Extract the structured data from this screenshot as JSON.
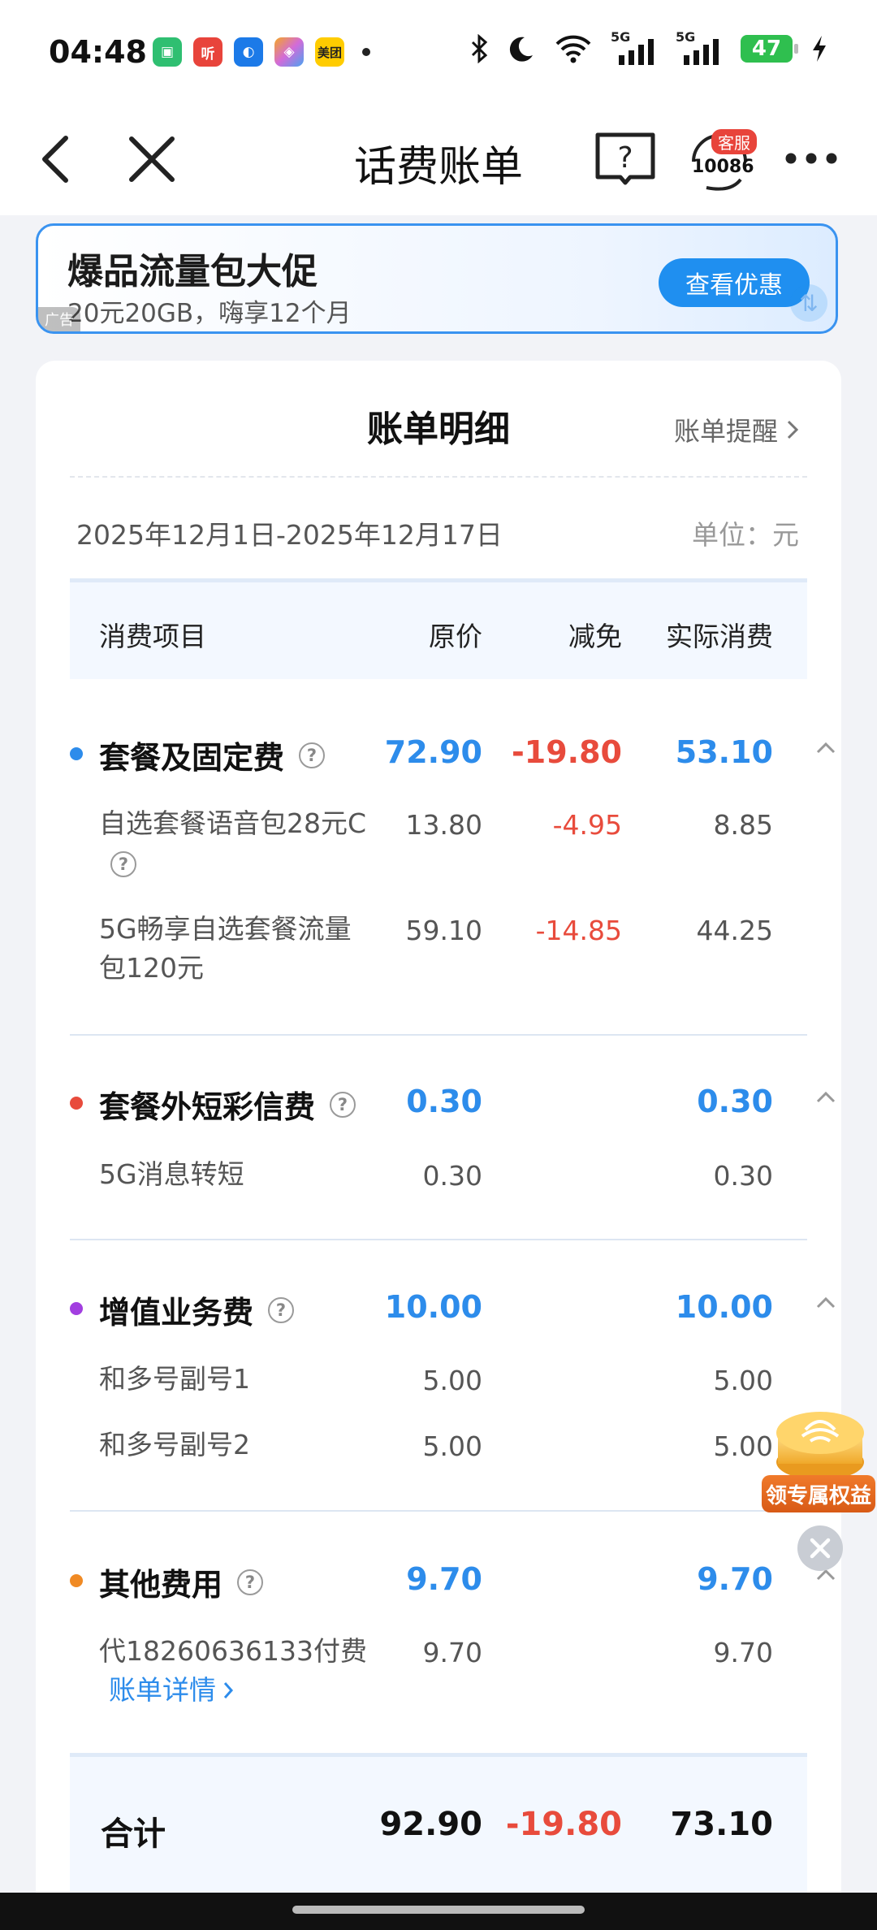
{
  "status_bar": {
    "time": "04:48",
    "apps": [
      {
        "name": "app-green",
        "glyph": "▣",
        "color": "#2fbf71"
      },
      {
        "name": "app-ting",
        "glyph": "听",
        "color": "#e8443b"
      },
      {
        "name": "app-blue",
        "glyph": "◐",
        "color": "#1c7ae8"
      },
      {
        "name": "app-color",
        "glyph": "◈",
        "color": "#d26bd9"
      },
      {
        "name": "app-meituan",
        "glyph": "美团",
        "color": "#ffcc00"
      }
    ],
    "signal_label_1": "5G",
    "signal_label_2": "5G",
    "battery": "47"
  },
  "nav": {
    "title": "话费账单",
    "service_badge": "客服",
    "service_number": "10086"
  },
  "banner": {
    "title": "爆品流量包大促",
    "subtitle": "20元20GB，嗨享12个月",
    "button": "查看优惠",
    "ad_tag": "广告"
  },
  "bill": {
    "title": "账单明细",
    "reminder": "账单提醒",
    "period": "2025年12月1日-2025年12月17日",
    "unit": "单位：元",
    "columns": [
      "消费项目",
      "原价",
      "减免",
      "实际消费"
    ],
    "categories": [
      {
        "name": "套餐及固定费",
        "bullet_color": "#2d8ceb",
        "original": "72.90",
        "discount": "-19.80",
        "actual": "53.10",
        "items": [
          {
            "name": "自选套餐语音包28元C",
            "original": "13.80",
            "discount": "-4.95",
            "actual": "8.85"
          },
          {
            "name": "5G畅享自选套餐流量包120元",
            "original": "59.10",
            "discount": "-14.85",
            "actual": "44.25"
          }
        ]
      },
      {
        "name": "套餐外短彩信费",
        "bullet_color": "#e84b3c",
        "original": "0.30",
        "discount": "",
        "actual": "0.30",
        "items": [
          {
            "name": "5G消息转短",
            "original": "0.30",
            "discount": "",
            "actual": "0.30"
          }
        ]
      },
      {
        "name": "增值业务费",
        "bullet_color": "#a23ee0",
        "original": "10.00",
        "discount": "",
        "actual": "10.00",
        "items": [
          {
            "name": "和多号副号1",
            "original": "5.00",
            "discount": "",
            "actual": "5.00"
          },
          {
            "name": "和多号副号2",
            "original": "5.00",
            "discount": "",
            "actual": "5.00"
          }
        ]
      },
      {
        "name": "其他费用",
        "bullet_color": "#f08a24",
        "original": "9.70",
        "discount": "",
        "actual": "9.70",
        "items": [
          {
            "name": "代18260636133付费",
            "original": "9.70",
            "discount": "",
            "actual": "9.70",
            "link": "账单详情"
          }
        ]
      }
    ],
    "total": {
      "label": "合计",
      "original": "92.90",
      "discount": "-19.80",
      "actual": "73.10"
    }
  },
  "floating": {
    "badge_label": "领专属权益"
  }
}
